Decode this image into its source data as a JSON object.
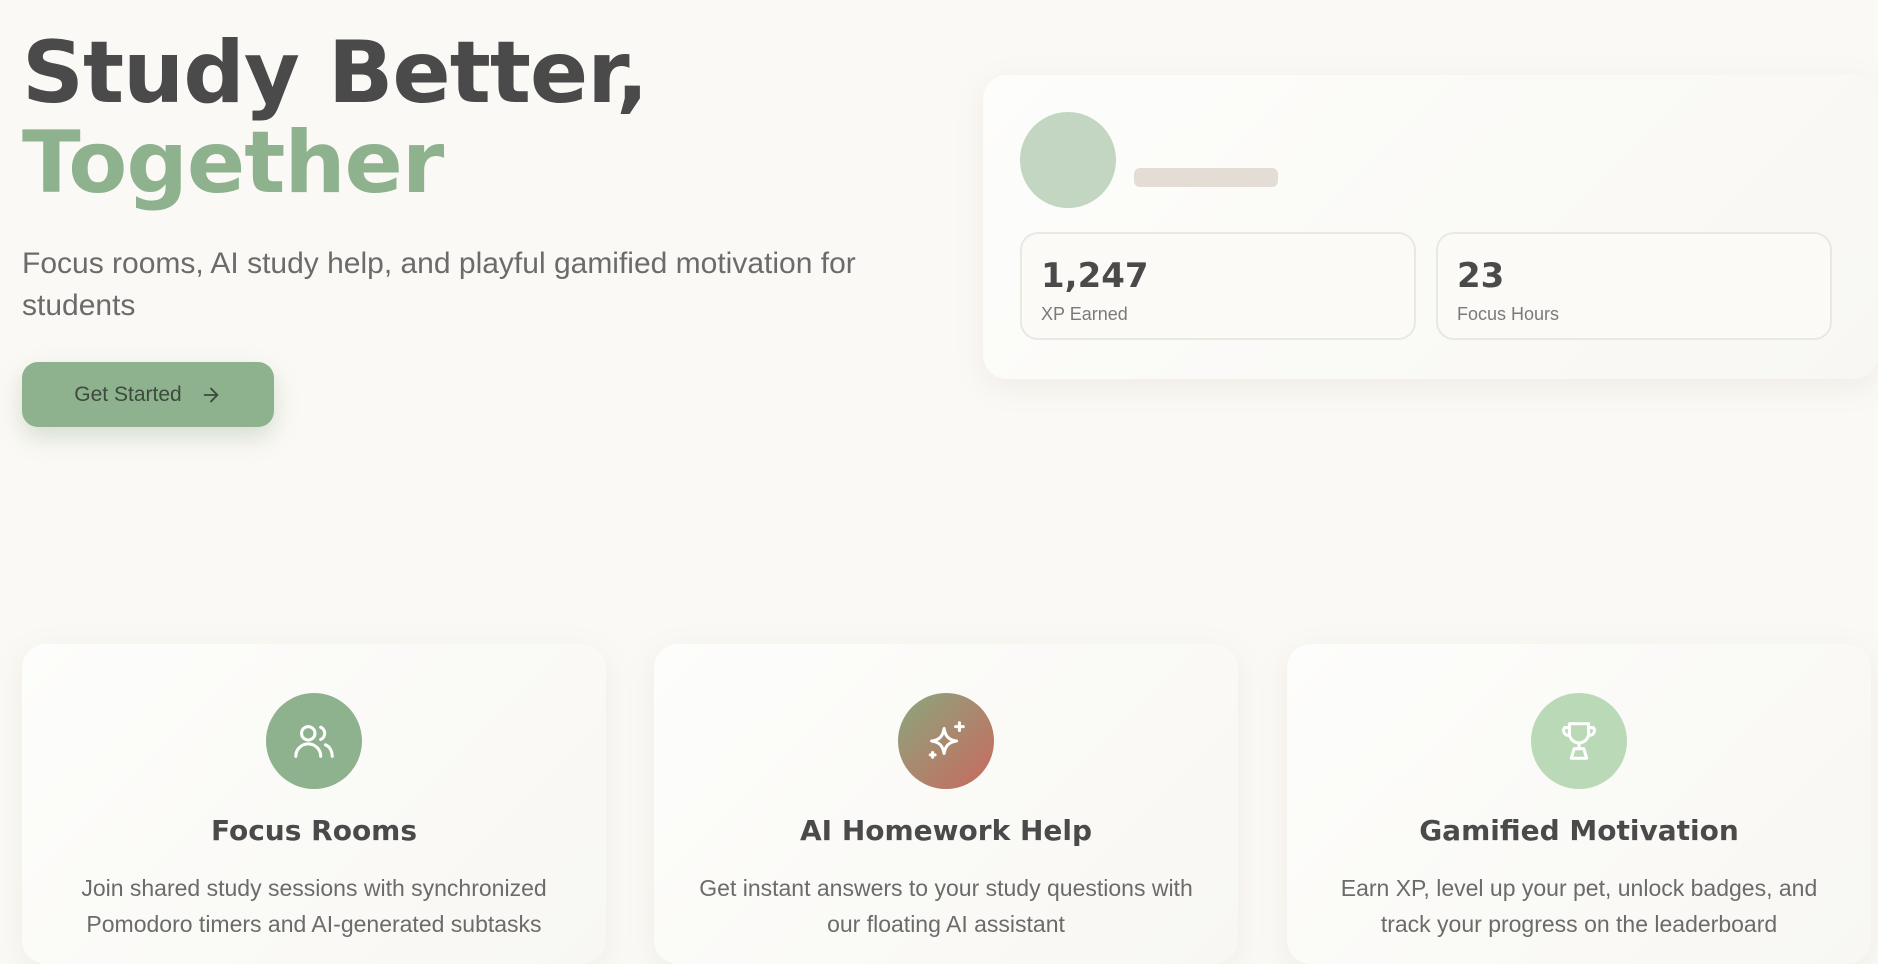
{
  "hero": {
    "title_line1": "Study Better,",
    "title_line2": "Together",
    "subtitle": "Focus rooms, AI study help, and playful gamified motivation for students",
    "cta_label": "Get Started",
    "cta_icon": "arrow-right-icon"
  },
  "profile_card": {
    "stats": [
      {
        "value": "1,247",
        "label": "XP Earned"
      },
      {
        "value": "23",
        "label": "Focus Hours"
      }
    ]
  },
  "features": [
    {
      "title": "Focus Rooms",
      "description": "Join shared study sessions with synchronized Pomodoro timers and AI-generated subtasks",
      "icon": "users-icon",
      "color": "#8db28d"
    },
    {
      "title": "AI Homework Help",
      "description": "Get instant answers to your study questions with our floating AI assistant",
      "icon": "sparkle-icon",
      "color": "#c9695e"
    },
    {
      "title": "Gamified Motivation",
      "description": "Earn XP, level up your pet, unlock badges, and track your progress on the leaderboard",
      "icon": "trophy-icon",
      "color": "#b9d9b7"
    }
  ],
  "colors": {
    "background": "#fbf9f5",
    "accent_green": "#8db28d",
    "text_dark": "#4a4a4a"
  }
}
